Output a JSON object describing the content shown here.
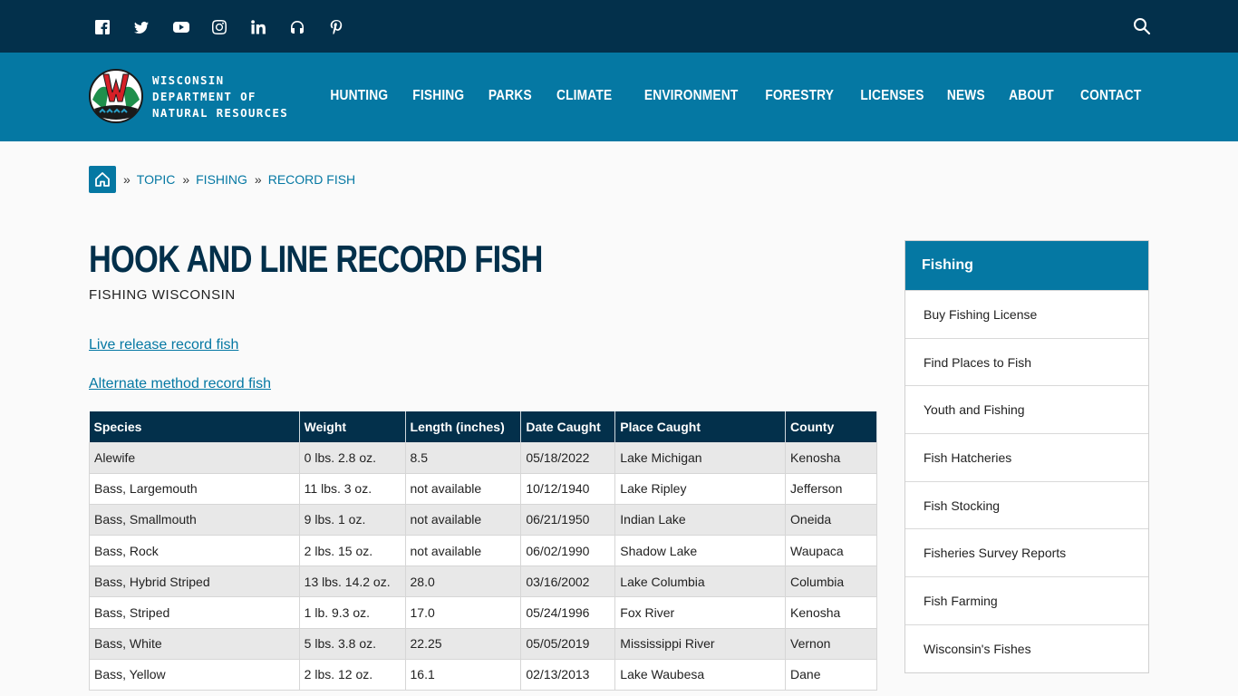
{
  "social": [
    {
      "name": "facebook-icon"
    },
    {
      "name": "twitter-icon"
    },
    {
      "name": "youtube-icon"
    },
    {
      "name": "instagram-icon"
    },
    {
      "name": "linkedin-icon"
    },
    {
      "name": "podcast-icon"
    },
    {
      "name": "pinterest-icon"
    }
  ],
  "logo": {
    "line1": "WISCONSIN",
    "line2": "DEPARTMENT OF",
    "line3": "NATURAL RESOURCES"
  },
  "nav": [
    "HUNTING",
    "FISHING",
    "PARKS",
    "CLIMATE",
    "ENVIRONMENT",
    "FORESTRY",
    "LICENSES",
    "NEWS",
    "ABOUT",
    "CONTACT"
  ],
  "breadcrumb": {
    "sep": "»",
    "items": [
      "TOPIC",
      "FISHING",
      "RECORD FISH"
    ]
  },
  "page": {
    "title": "HOOK AND LINE RECORD FISH",
    "subtitle": "FISHING WISCONSIN",
    "link1": "Live release record fish",
    "link2": "Alternate method record fish"
  },
  "table": {
    "headers": [
      "Species",
      "Weight",
      "Length (inches)",
      "Date Caught",
      "Place Caught",
      "County"
    ],
    "rows": [
      [
        "Alewife",
        "0 lbs. 2.8 oz.",
        "8.5",
        "05/18/2022",
        "Lake Michigan",
        "Kenosha"
      ],
      [
        "Bass, Largemouth",
        "11 lbs. 3 oz.",
        "not available",
        "10/12/1940",
        "Lake Ripley",
        "Jefferson"
      ],
      [
        "Bass, Smallmouth",
        "9 lbs. 1 oz.",
        "not available",
        "06/21/1950",
        "Indian Lake",
        "Oneida"
      ],
      [
        "Bass, Rock",
        "2 lbs. 15 oz.",
        "not available",
        "06/02/1990",
        "Shadow Lake",
        "Waupaca"
      ],
      [
        "Bass, Hybrid Striped",
        "13 lbs. 14.2 oz.",
        "28.0",
        "03/16/2002",
        "Lake Columbia",
        "Columbia"
      ],
      [
        "Bass, Striped",
        "1 lb. 9.3 oz.",
        "17.0",
        "05/24/1996",
        "Fox River",
        "Kenosha"
      ],
      [
        "Bass, White",
        "5 lbs. 3.8 oz.",
        "22.25",
        "05/05/2019",
        "Mississippi River",
        "Vernon"
      ],
      [
        "Bass, Yellow",
        "2 lbs. 12 oz.",
        "16.1",
        "02/13/2013",
        "Lake Waubesa",
        "Dane"
      ]
    ]
  },
  "sidebar": {
    "title": "Fishing",
    "items": [
      "Buy Fishing License",
      "Find Places to Fish",
      "Youth and Fishing",
      "Fish Hatcheries",
      "Fish Stocking",
      "Fisheries Survey Reports",
      "Fish Farming",
      "Wisconsin's Fishes"
    ]
  },
  "colors": {
    "dark_navy": "#03304b",
    "brand_blue": "#0578a3"
  }
}
